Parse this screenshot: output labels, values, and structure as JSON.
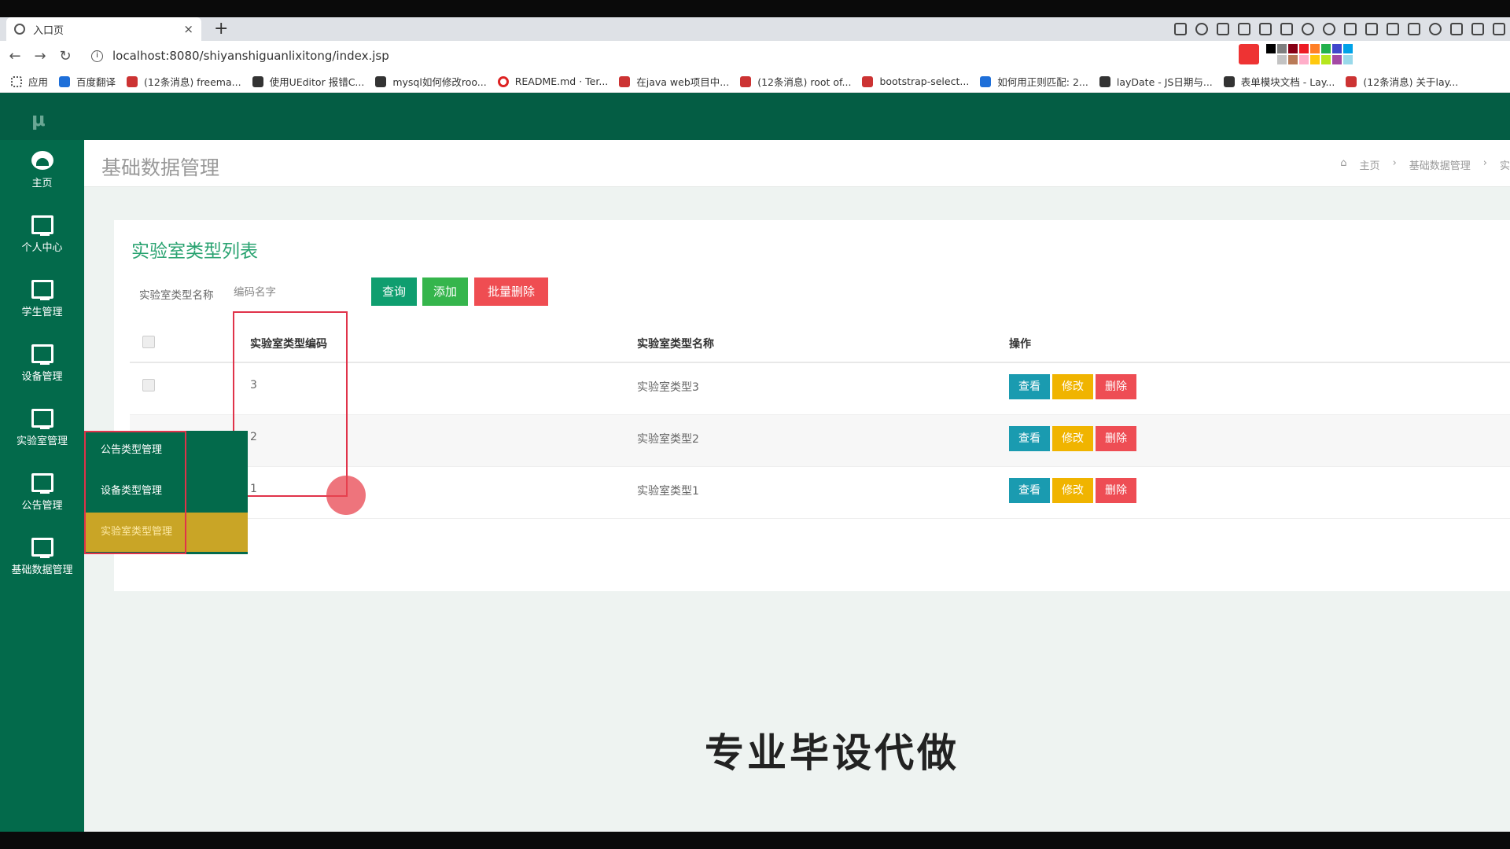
{
  "browser": {
    "tab_title": "入口页",
    "url": "localhost:8080/shiyanshiguanlixitong/index.jsp",
    "bookmarks": [
      "应用",
      "百度翻译",
      "(12条消息) freema...",
      "使用UEditor 报错C...",
      "mysql如何修改roo...",
      "README.md · Ter...",
      "在java web项目中...",
      "(12条消息) root of...",
      "bootstrap-select...",
      "如何用正则匹配: 2...",
      "layDate - JS日期与...",
      "表单模块文档 - Lay...",
      "(12条消息) 关于lay..."
    ],
    "palette_colors": [
      "#000000",
      "#7f7f7f",
      "#880015",
      "#ed1c24",
      "#ff7f27",
      "#22b14c",
      "#3f48cc",
      "#00a2e8",
      "#ffffff",
      "#c3c3c3",
      "#b97a57",
      "#ffaec9",
      "#ffc90e",
      "#b5e61d",
      "#a349a4",
      "#99d9ea"
    ]
  },
  "app": {
    "logo": "μ",
    "sidebar": [
      {
        "label": "主页",
        "icon": "dashboard-icon"
      },
      {
        "label": "个人中心",
        "icon": "monitor-icon"
      },
      {
        "label": "学生管理",
        "icon": "monitor-icon"
      },
      {
        "label": "设备管理",
        "icon": "monitor-icon"
      },
      {
        "label": "实验室管理",
        "icon": "monitor-icon"
      },
      {
        "label": "公告管理",
        "icon": "monitor-icon"
      },
      {
        "label": "基础数据管理",
        "icon": "monitor-icon"
      }
    ],
    "submenu": [
      "公告类型管理",
      "设备类型管理",
      "实验室类型管理"
    ],
    "page_title": "基础数据管理",
    "breadcrumb": [
      "主页",
      "基础数据管理",
      "实"
    ],
    "panel_title": "实验室类型列表",
    "search": {
      "label": "实验室类型名称",
      "placeholder": "编码名字"
    },
    "buttons": {
      "query": "查询",
      "add": "添加",
      "batch_delete": "批量删除"
    },
    "table": {
      "headers": {
        "code": "实验室类型编码",
        "name": "实验室类型名称",
        "ops": "操作"
      },
      "rows": [
        {
          "code": "3",
          "name": "实验室类型3"
        },
        {
          "code": "2",
          "name": "实验室类型2"
        },
        {
          "code": "1",
          "name": "实验室类型1"
        }
      ],
      "op_labels": {
        "view": "查看",
        "edit": "修改",
        "delete": "删除"
      }
    },
    "bottom_caption": "专业毕设代做"
  },
  "colors": {
    "topnav": "#045d44",
    "sidebar": "#036a4b",
    "accent_green": "#2aa371",
    "submenu_active": "#c9a526",
    "danger": "#ee4d54"
  }
}
